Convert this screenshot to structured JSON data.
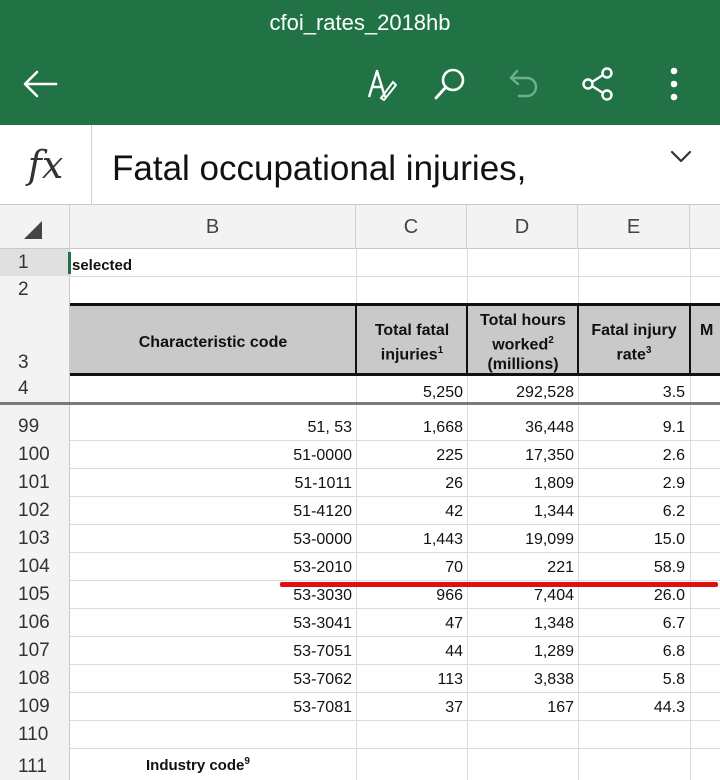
{
  "app": {
    "doc_title": "cfoi_rates_2018hb",
    "toolbar_icons": [
      "back-arrow-icon",
      "draw-pen-icon",
      "search-icon",
      "undo-icon",
      "share-icon",
      "more-vertical-icon"
    ]
  },
  "formula_bar": {
    "fx_label": "fx",
    "content": "Fatal occupational injuries,"
  },
  "columns": [
    "B",
    "C",
    "D",
    "E"
  ],
  "row1": {
    "num": "1",
    "text": "selected"
  },
  "row2": {
    "num": "2"
  },
  "header": {
    "num": "3",
    "b": "Characteristic code",
    "c": "Total fatal injuries",
    "c_sup": "1",
    "d1": "Total hours",
    "d2": "worked",
    "d_sup": "2",
    "d3": "(millions)",
    "e1": "Fatal injury",
    "e2": "rate",
    "e_sup": "3",
    "f": "M"
  },
  "row4": {
    "num": "4",
    "c": "5,250",
    "d": "292,528",
    "e": "3.5"
  },
  "rows": [
    {
      "num": "99",
      "code": "51, 53",
      "c": "1,668",
      "d": "36,448",
      "e": "9.1"
    },
    {
      "num": "100",
      "code": "51-0000",
      "c": "225",
      "d": "17,350",
      "e": "2.6"
    },
    {
      "num": "101",
      "code": "51-1011",
      "c": "26",
      "d": "1,809",
      "e": "2.9"
    },
    {
      "num": "102",
      "code": "51-4120",
      "c": "42",
      "d": "1,344",
      "e": "6.2"
    },
    {
      "num": "103",
      "code": "53-0000",
      "c": "1,443",
      "d": "19,099",
      "e": "15.0"
    },
    {
      "num": "104",
      "code": "53-2010",
      "c": "70",
      "d": "221",
      "e": "58.9"
    },
    {
      "num": "105",
      "code": "53-3030",
      "c": "966",
      "d": "7,404",
      "e": "26.0"
    },
    {
      "num": "106",
      "code": "53-3041",
      "c": "47",
      "d": "1,348",
      "e": "6.7"
    },
    {
      "num": "107",
      "code": "53-7051",
      "c": "44",
      "d": "1,289",
      "e": "6.8"
    },
    {
      "num": "108",
      "code": "53-7062",
      "c": "113",
      "d": "3,838",
      "e": "5.8"
    },
    {
      "num": "109",
      "code": "53-7081",
      "c": "37",
      "d": "167",
      "e": "44.3"
    }
  ],
  "row110": {
    "num": "110"
  },
  "row111": {
    "num": "111",
    "text": "Industry code",
    "sup": "9"
  },
  "colors": {
    "toolbar": "#217346",
    "annotation": "#e01010"
  }
}
